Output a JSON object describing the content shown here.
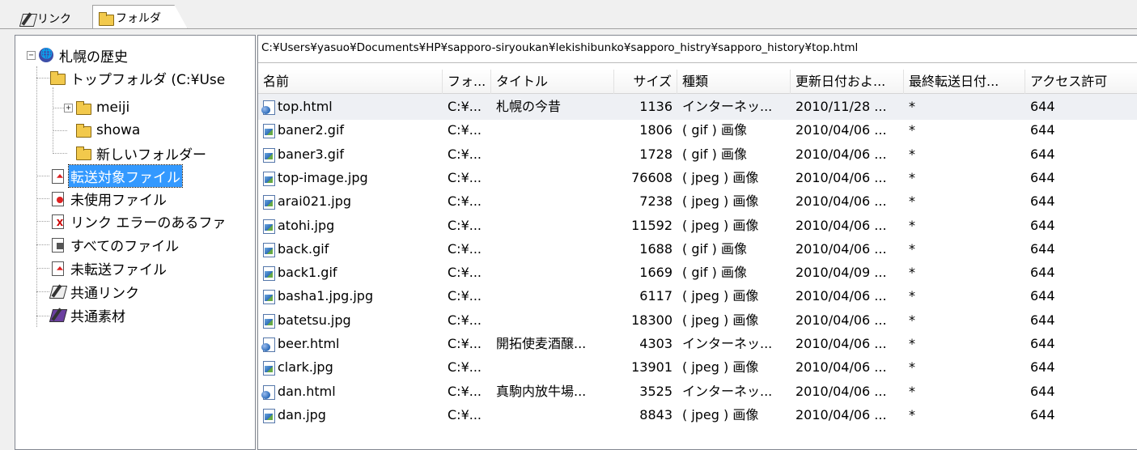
{
  "tabs": [
    {
      "label": "リンク",
      "icon": "link-tab-icon",
      "active": false
    },
    {
      "label": "フォルダ",
      "icon": "folder-tab-icon",
      "active": true
    }
  ],
  "tree": {
    "root": {
      "label": "札幌の歴史",
      "icon": "site-icon"
    },
    "top_folder": {
      "label": "トップフォルダ (C:¥Use",
      "icon": "folder-icon"
    },
    "folders": [
      {
        "label": "meiji",
        "icon": "folder-icon"
      },
      {
        "label": "showa",
        "icon": "folder-icon"
      },
      {
        "label": "新しいフォルダー",
        "icon": "folder-icon"
      }
    ],
    "categories": [
      {
        "label": "転送対象ファイル",
        "icon": "upload-file-icon",
        "selected": true
      },
      {
        "label": "未使用ファイル",
        "icon": "unused-file-icon"
      },
      {
        "label": "リンク エラーのあるファ",
        "icon": "link-error-icon"
      },
      {
        "label": "すべてのファイル",
        "icon": "all-files-icon"
      },
      {
        "label": "未転送ファイル",
        "icon": "not-transferred-icon"
      },
      {
        "label": "共通リンク",
        "icon": "common-link-icon"
      },
      {
        "label": "共通素材",
        "icon": "common-material-icon"
      }
    ]
  },
  "path": "C:¥Users¥yasuo¥Documents¥HP¥sapporo-siryoukan¥lekishibunko¥sapporo_histry¥sapporo_history¥top.html",
  "columns": {
    "name": "名前",
    "folder": "フォ...",
    "title": "タイトル",
    "size": "サイズ",
    "type": "種類",
    "modified": "更新日付およ...",
    "last_sent": "最終転送日付...",
    "access": "アクセス許可"
  },
  "files": [
    {
      "name": "top.html",
      "kind": "html",
      "folder": "C:¥...",
      "title": "札幌の今昔",
      "size": "1136",
      "type": "インターネッ...",
      "modified": "2010/11/28 ...",
      "last_sent": "*",
      "access": "644"
    },
    {
      "name": "baner2.gif",
      "kind": "img",
      "folder": "C:¥...",
      "title": "",
      "size": "1806",
      "type": "( gif ) 画像",
      "modified": "2010/04/06 ...",
      "last_sent": "*",
      "access": "644"
    },
    {
      "name": "baner3.gif",
      "kind": "img",
      "folder": "C:¥...",
      "title": "",
      "size": "1728",
      "type": "( gif ) 画像",
      "modified": "2010/04/06 ...",
      "last_sent": "*",
      "access": "644"
    },
    {
      "name": "top-image.jpg",
      "kind": "img",
      "folder": "C:¥...",
      "title": "",
      "size": "76608",
      "type": "( jpeg ) 画像",
      "modified": "2010/04/06 ...",
      "last_sent": "*",
      "access": "644"
    },
    {
      "name": "arai021.jpg",
      "kind": "img",
      "folder": "C:¥...",
      "title": "",
      "size": "7238",
      "type": "( jpeg ) 画像",
      "modified": "2010/04/06 ...",
      "last_sent": "*",
      "access": "644"
    },
    {
      "name": "atohi.jpg",
      "kind": "img",
      "folder": "C:¥...",
      "title": "",
      "size": "11592",
      "type": "( jpeg ) 画像",
      "modified": "2010/04/06 ...",
      "last_sent": "*",
      "access": "644"
    },
    {
      "name": "back.gif",
      "kind": "img",
      "folder": "C:¥...",
      "title": "",
      "size": "1688",
      "type": "( gif ) 画像",
      "modified": "2010/04/06 ...",
      "last_sent": "*",
      "access": "644"
    },
    {
      "name": "back1.gif",
      "kind": "img",
      "folder": "C:¥...",
      "title": "",
      "size": "1669",
      "type": "( gif ) 画像",
      "modified": "2010/04/09 ...",
      "last_sent": "*",
      "access": "644"
    },
    {
      "name": "basha1.jpg.jpg",
      "kind": "img",
      "folder": "C:¥...",
      "title": "",
      "size": "6117",
      "type": "( jpeg ) 画像",
      "modified": "2010/04/06 ...",
      "last_sent": "*",
      "access": "644"
    },
    {
      "name": "batetsu.jpg",
      "kind": "img",
      "folder": "C:¥...",
      "title": "",
      "size": "18300",
      "type": "( jpeg ) 画像",
      "modified": "2010/04/06 ...",
      "last_sent": "*",
      "access": "644"
    },
    {
      "name": "beer.html",
      "kind": "html",
      "folder": "C:¥...",
      "title": "開拓使麦酒醸...",
      "size": "4303",
      "type": "インターネッ...",
      "modified": "2010/04/06 ...",
      "last_sent": "*",
      "access": "644"
    },
    {
      "name": "clark.jpg",
      "kind": "img",
      "folder": "C:¥...",
      "title": "",
      "size": "13901",
      "type": "( jpeg ) 画像",
      "modified": "2010/04/06 ...",
      "last_sent": "*",
      "access": "644"
    },
    {
      "name": "dan.html",
      "kind": "html",
      "folder": "C:¥...",
      "title": "真駒内放牛場...",
      "size": "3525",
      "type": "インターネッ...",
      "modified": "2010/04/06 ...",
      "last_sent": "*",
      "access": "644"
    },
    {
      "name": "dan.jpg",
      "kind": "img",
      "folder": "C:¥...",
      "title": "",
      "size": "8843",
      "type": "( jpeg ) 画像",
      "modified": "2010/04/06 ...",
      "last_sent": "*",
      "access": "644"
    }
  ]
}
